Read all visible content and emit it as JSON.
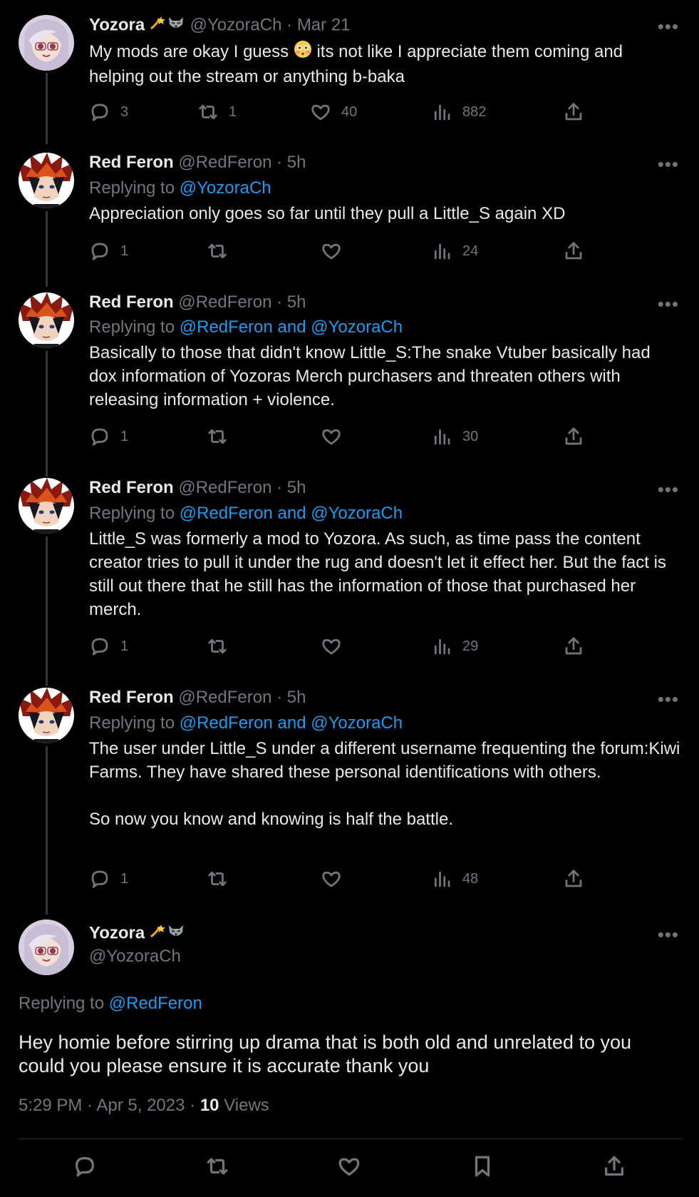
{
  "tweets": [
    {
      "name": "Yozora",
      "handle": "@YozoraCh",
      "time": "Mar 21",
      "replying_prefix": "",
      "replying_to": "",
      "text": "My mods are okay I guess 😳 its not like I appreciate them coming and helping out the stream or anything b-baka",
      "replies": "3",
      "reposts": "1",
      "likes": "40",
      "views": "882"
    },
    {
      "name": "Red Feron",
      "handle": "@RedFeron",
      "time": "5h",
      "replying_prefix": "Replying to",
      "replying_to": "@YozoraCh",
      "text": "Appreciation only goes so far until they pull a Little_S again XD",
      "replies": "1",
      "reposts": "",
      "likes": "",
      "views": "24"
    },
    {
      "name": "Red Feron",
      "handle": "@RedFeron",
      "time": "5h",
      "replying_prefix": "Replying to",
      "replying_to": "@RedFeron and @YozoraCh",
      "text": "Basically to those that didn't know Little_S:The snake Vtuber basically had dox information of Yozoras Merch purchasers and threaten others with releasing information + violence.",
      "replies": "1",
      "reposts": "",
      "likes": "",
      "views": "30"
    },
    {
      "name": "Red Feron",
      "handle": "@RedFeron",
      "time": "5h",
      "replying_prefix": "Replying to",
      "replying_to": "@RedFeron and @YozoraCh",
      "text": "Little_S was formerly a mod to Yozora. As such, as time pass the content creator tries to pull it under the rug and doesn't let it effect her. But the fact is still out there that he still has the information of those that purchased her merch.",
      "replies": "1",
      "reposts": "",
      "likes": "",
      "views": "29"
    },
    {
      "name": "Red Feron",
      "handle": "@RedFeron",
      "time": "5h",
      "replying_prefix": "Replying to",
      "replying_to": "@RedFeron and @YozoraCh",
      "text": "The user under Little_S under a different username frequenting the forum:Kiwi Farms. They have shared these personal identifications with others.\n\nSo now you know and knowing is half the battle.",
      "replies": "1",
      "reposts": "",
      "likes": "",
      "views": "48"
    }
  ],
  "main": {
    "name": "Yozora",
    "handle": "@YozoraCh",
    "replying_prefix": "Replying to",
    "replying_to": "@RedFeron",
    "text": "Hey homie before stirring up drama that is both old and unrelated to you could you please ensure it is accurate thank you",
    "meta_time": "5:29 PM · Apr 5, 2023 · ",
    "views_count": "10",
    "views_label": "Views"
  },
  "icons": [
    "reply-icon",
    "repost-icon",
    "like-icon",
    "views-icon",
    "share-icon",
    "bookmark-icon",
    "more-icon"
  ],
  "colors": {
    "background": "#000000",
    "text": "#e7e9ea",
    "muted": "#71767b",
    "link": "#1d9bf0",
    "divider": "#2f3336"
  }
}
